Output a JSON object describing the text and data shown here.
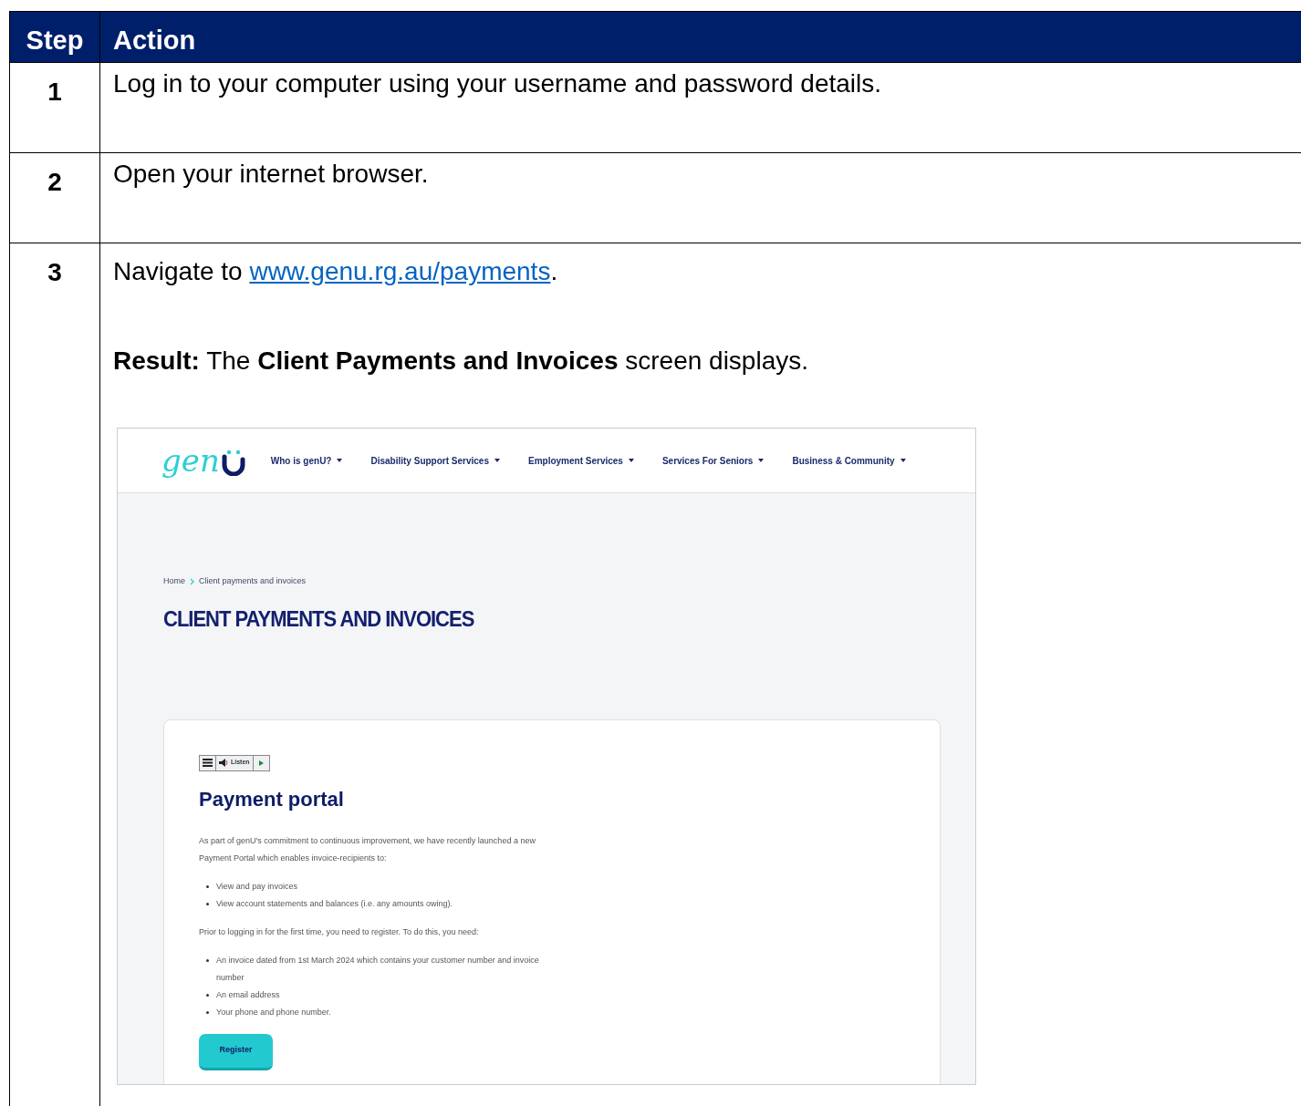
{
  "table": {
    "columns": [
      "Step",
      "Action"
    ],
    "rows": [
      {
        "step": "1",
        "action": "Log in to your computer using your username and password details."
      },
      {
        "step": "2",
        "action": "Open your internet browser."
      },
      {
        "step": "3",
        "action": "Navigate to ",
        "link": "www.genu.rg.au/payments",
        "action_end": ".",
        "result": "**Result:** The **Client Payments and Invoices** screen displays.",
        "screenshot": {
          "logo": "gen",
          "nav": [
            "Who is genU?",
            "Disability Support Services",
            "Employment Services",
            "Services For Seniors",
            "Business & Community"
          ],
          "breadcrumb": [
            "Home",
            "Client payments and invoices"
          ],
          "page_title": "CLIENT PAYMENTS AND INVOICES",
          "listen_label": "Listen",
          "card_title": "Payment portal",
          "intro": "As part of genU's commitment to continuous improvement, we have recently launched a new Payment Portal which enables invoice-recipients to:",
          "list_1": [
            "View and pay invoices",
            "View account statements and balances (i.e. any amounts owing)."
          ],
          "paragraph_2": "Prior to logging in for the first time, you need to register. To do this, you need:",
          "list_2": [
            "An invoice dated from 1st March 2024 which contains your customer number and invoice number",
            "An email address",
            "Your phone and phone number."
          ],
          "button": "Register"
        }
      }
    ]
  }
}
